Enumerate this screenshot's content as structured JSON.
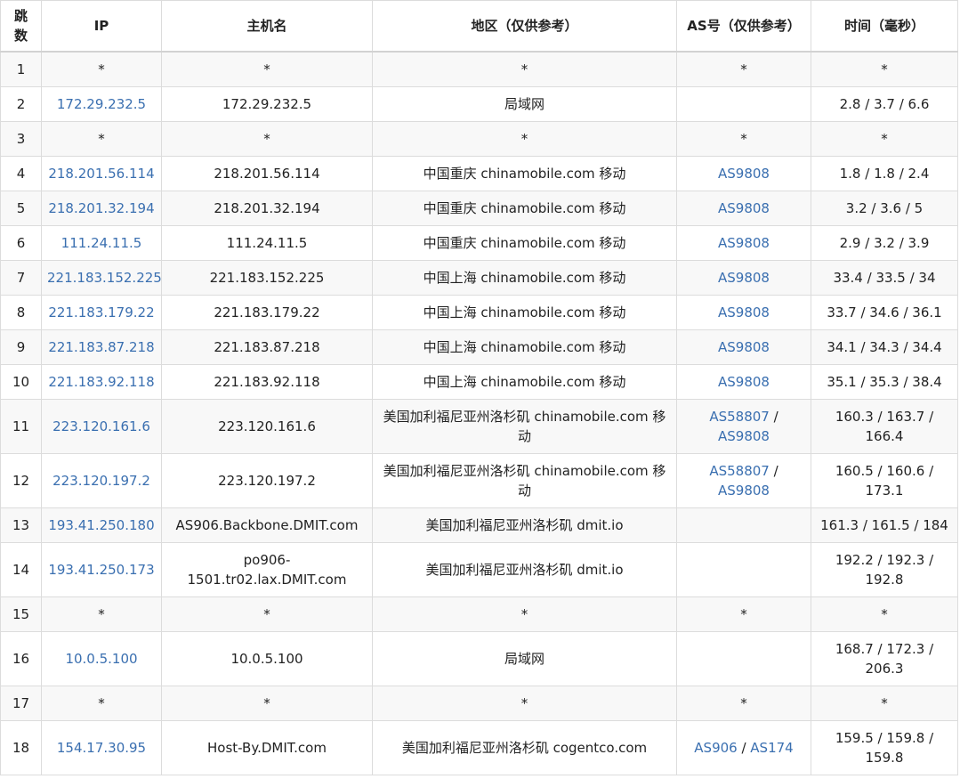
{
  "headers": {
    "hop_line1": "跳",
    "hop_line2": "数",
    "ip": "IP",
    "host": "主机名",
    "geo": "地区（仅供参考）",
    "as": "AS号（仅供参考）",
    "time": "时间（毫秒）"
  },
  "rows": [
    {
      "hop": "1",
      "ip": "*",
      "host": "*",
      "geo": "*",
      "as": "*",
      "time": "*"
    },
    {
      "hop": "2",
      "ip": "172.29.232.5",
      "host": "172.29.232.5",
      "geo": "局域网",
      "as": "",
      "time": "2.8 / 3.7 / 6.6"
    },
    {
      "hop": "3",
      "ip": "*",
      "host": "*",
      "geo": "*",
      "as": "*",
      "time": "*"
    },
    {
      "hop": "4",
      "ip": "218.201.56.114",
      "host": "218.201.56.114",
      "geo": "中国重庆 chinamobile.com 移动",
      "as": "AS9808",
      "time": "1.8 / 1.8 / 2.4"
    },
    {
      "hop": "5",
      "ip": "218.201.32.194",
      "host": "218.201.32.194",
      "geo": "中国重庆 chinamobile.com 移动",
      "as": "AS9808",
      "time": "3.2 / 3.6 / 5"
    },
    {
      "hop": "6",
      "ip": "111.24.11.5",
      "host": "111.24.11.5",
      "geo": "中国重庆 chinamobile.com 移动",
      "as": "AS9808",
      "time": "2.9 / 3.2 / 3.9"
    },
    {
      "hop": "7",
      "ip": "221.183.152.225",
      "host": "221.183.152.225",
      "geo": "中国上海 chinamobile.com 移动",
      "as": "AS9808",
      "time": "33.4 / 33.5 / 34"
    },
    {
      "hop": "8",
      "ip": "221.183.179.22",
      "host": "221.183.179.22",
      "geo": "中国上海 chinamobile.com 移动",
      "as": "AS9808",
      "time": "33.7 / 34.6 / 36.1"
    },
    {
      "hop": "9",
      "ip": "221.183.87.218",
      "host": "221.183.87.218",
      "geo": "中国上海 chinamobile.com 移动",
      "as": "AS9808",
      "time": "34.1 / 34.3 / 34.4"
    },
    {
      "hop": "10",
      "ip": "221.183.92.118",
      "host": "221.183.92.118",
      "geo": "中国上海 chinamobile.com 移动",
      "as": "AS9808",
      "time": "35.1 / 35.3 / 38.4"
    },
    {
      "hop": "11",
      "ip": "223.120.161.6",
      "host": "223.120.161.6",
      "geo": "美国加利福尼亚州洛杉矶 chinamobile.com 移动",
      "as_a": "AS58807",
      "as_sep": " / ",
      "as_b": "AS9808",
      "time": "160.3 / 163.7 / 166.4"
    },
    {
      "hop": "12",
      "ip": "223.120.197.2",
      "host": "223.120.197.2",
      "geo": "美国加利福尼亚州洛杉矶 chinamobile.com 移动",
      "as_a": "AS58807",
      "as_sep": " / ",
      "as_b": "AS9808",
      "time": "160.5 / 160.6 / 173.1"
    },
    {
      "hop": "13",
      "ip": "193.41.250.180",
      "host": "AS906.Backbone.DMIT.com",
      "geo": "美国加利福尼亚州洛杉矶 dmit.io",
      "as": "",
      "time": "161.3 / 161.5 / 184"
    },
    {
      "hop": "14",
      "ip": "193.41.250.173",
      "host": "po906-1501.tr02.lax.DMIT.com",
      "geo": "美国加利福尼亚州洛杉矶 dmit.io",
      "as": "",
      "time": "192.2 / 192.3 / 192.8"
    },
    {
      "hop": "15",
      "ip": "*",
      "host": "*",
      "geo": "*",
      "as": "*",
      "time": "*"
    },
    {
      "hop": "16",
      "ip": "10.0.5.100",
      "host": "10.0.5.100",
      "geo": "局域网",
      "as": "",
      "time": "168.7 / 172.3 / 206.3"
    },
    {
      "hop": "17",
      "ip": "*",
      "host": "*",
      "geo": "*",
      "as": "*",
      "time": "*"
    },
    {
      "hop": "18",
      "ip": "154.17.30.95",
      "host": "Host-By.DMIT.com",
      "geo": "美国加利福尼亚州洛杉矶 cogentco.com",
      "as_a": "AS906",
      "as_sep": " / ",
      "as_b": "AS174",
      "time": "159.5 / 159.8 / 159.8"
    }
  ]
}
